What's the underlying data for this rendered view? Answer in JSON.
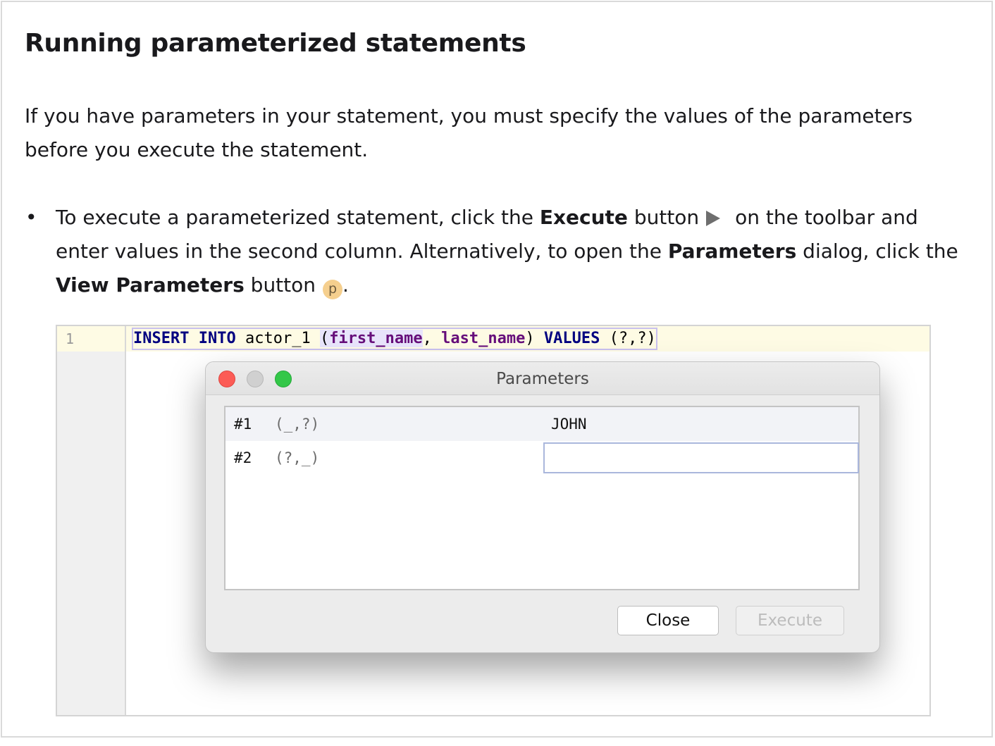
{
  "heading": "Running parameterized statements",
  "intro": "If you have parameters in your statement, you must specify the values of the parameters before you execute the statement.",
  "bullet": {
    "t1": "To execute a parameterized statement, click the ",
    "b1": "Execute",
    "t2": " button",
    "t3": " on the toolbar and enter values in the second column. Alternatively, to open the ",
    "b2": "Parameters",
    "t4": " dialog, click the ",
    "b3": "View Parameters",
    "t5": " button",
    "t6": ".",
    "execute_icon": "play-icon",
    "view_params_icon_letter": "p"
  },
  "editor": {
    "line_number": "1",
    "code": {
      "kw1": "INSERT",
      "kw2": "INTO",
      "table": "actor_1",
      "open": "(",
      "col1": "first_name",
      "comma": ",",
      "col2": "last_name",
      "close": ")",
      "kw3": "VALUES",
      "placeholders": "(?,?)"
    }
  },
  "dialog": {
    "title": "Parameters",
    "rows": [
      {
        "num": "#1",
        "pattern": "(_,?)",
        "value": "JOHN"
      },
      {
        "num": "#2",
        "pattern": "(?,_)",
        "value": ""
      }
    ],
    "close_label": "Close",
    "execute_label": "Execute"
  },
  "colors": {
    "keyword": "#000080",
    "column": "#660e7a",
    "current_line": "#fefbe4",
    "p_icon_bg": "#f5cf8e"
  }
}
